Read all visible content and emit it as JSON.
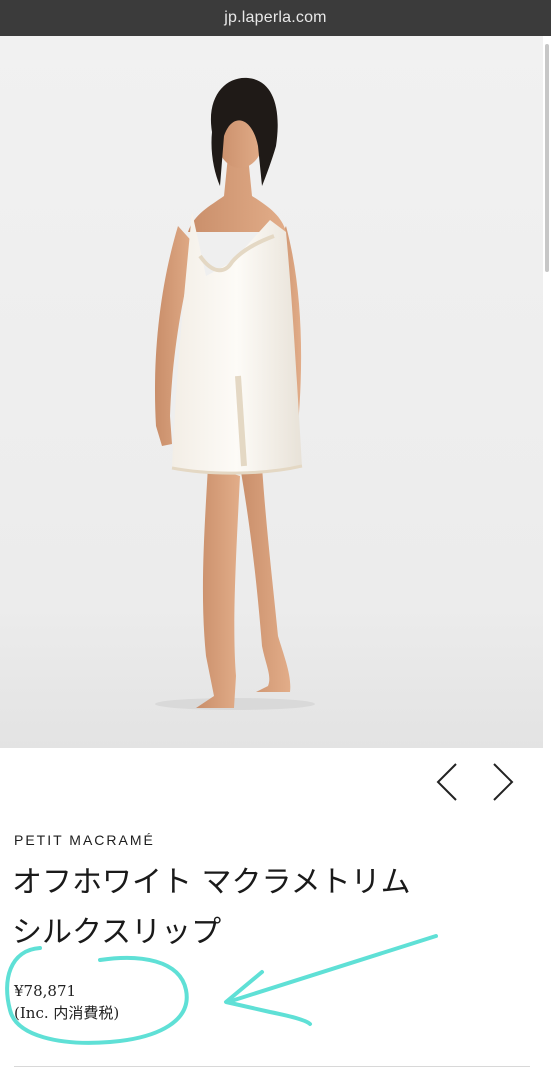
{
  "browser": {
    "url": "jp.laperla.com"
  },
  "product": {
    "image_icon": "product-photo-model-white-silk-slip",
    "collection": "PETIT MACRAMÉ",
    "title_line1": "オフホワイト マクラメトリム",
    "title_line2": "シルクスリップ",
    "price": "¥78,871",
    "tax_note": "(Inc. 内消費税)"
  },
  "carousel": {
    "prev_icon": "chevron-left-icon",
    "next_icon": "chevron-right-icon"
  },
  "colors": {
    "url_bar": "#3b3b3b",
    "annotation": "#5fe0d6",
    "text": "#1a1a1a"
  }
}
